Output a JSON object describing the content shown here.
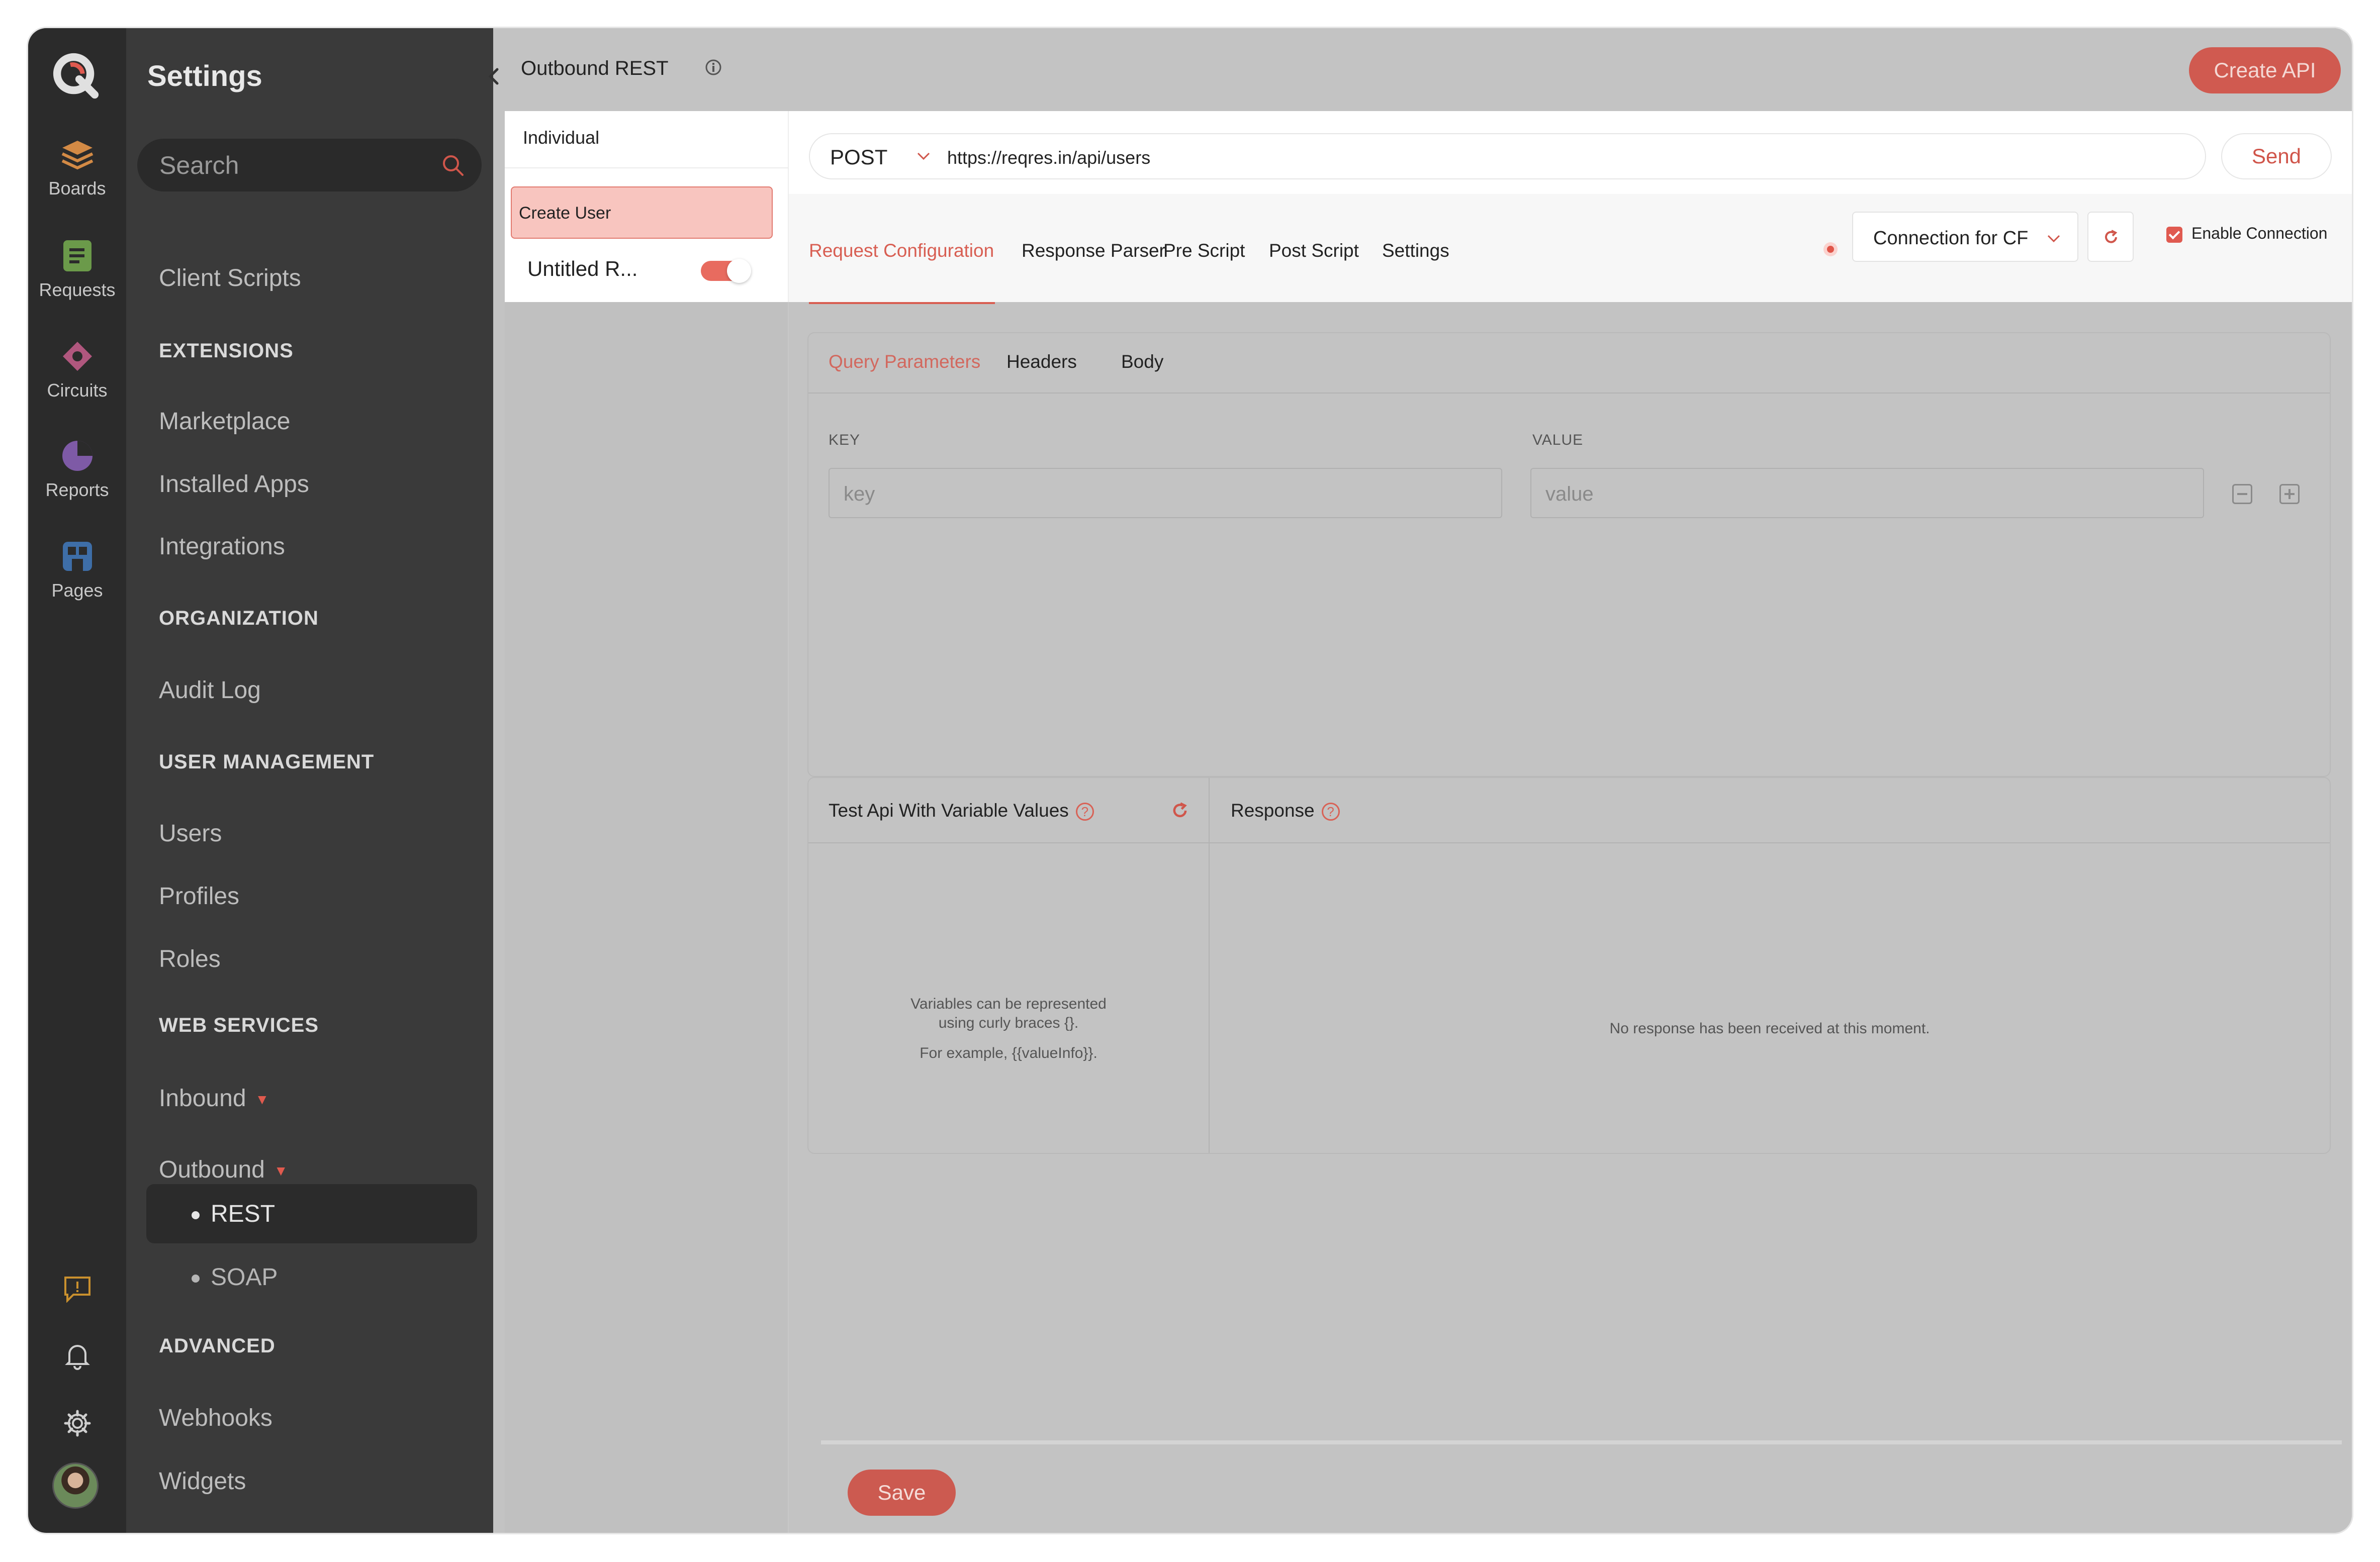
{
  "rail": {
    "items": [
      {
        "label": "Boards",
        "icon": "boards-icon"
      },
      {
        "label": "Requests",
        "icon": "requests-icon"
      },
      {
        "label": "Circuits",
        "icon": "circuits-icon"
      },
      {
        "label": "Reports",
        "icon": "reports-icon"
      },
      {
        "label": "Pages",
        "icon": "pages-icon"
      }
    ],
    "bottom_icons": [
      "feedback-icon",
      "bell-icon",
      "gear-icon",
      "avatar"
    ]
  },
  "sidebar": {
    "title": "Settings",
    "search_placeholder": "Search",
    "client_scripts": "Client Scripts",
    "sections": {
      "extensions": "EXTENSIONS",
      "organization": "ORGANIZATION",
      "user_management": "USER MANAGEMENT",
      "web_services": "WEB SERVICES",
      "advanced": "ADVANCED"
    },
    "items": {
      "marketplace": "Marketplace",
      "installed_apps": "Installed Apps",
      "integrations": "Integrations",
      "audit_log": "Audit Log",
      "users": "Users",
      "profiles": "Profiles",
      "roles": "Roles",
      "inbound": "Inbound",
      "outbound": "Outbound",
      "rest": "REST",
      "soap": "SOAP",
      "webhooks": "Webhooks",
      "widgets": "Widgets"
    }
  },
  "header": {
    "title": "Outbound REST",
    "create_api": "Create API"
  },
  "list_pane": {
    "tab": "Individual",
    "selected_item": "Create User",
    "item2": "Untitled R...",
    "item2_enabled": true
  },
  "request": {
    "method": "POST",
    "url": "https://reqres.in/api/users",
    "send_label": "Send"
  },
  "config_tabs": [
    "Request Configuration",
    "Response Parser",
    "Pre Script",
    "Post Script",
    "Settings"
  ],
  "active_config_tab": "Request Configuration",
  "connection": {
    "selected": "Connection for CF",
    "enable_label": "Enable Connection",
    "enabled": true
  },
  "params": {
    "tabs": [
      "Query Parameters",
      "Headers",
      "Body"
    ],
    "active_tab": "Query Parameters",
    "key_header": "KEY",
    "value_header": "VALUE",
    "key_placeholder": "key",
    "value_placeholder": "value"
  },
  "test_panel": {
    "title": "Test Api With Variable Values",
    "hint_line1": "Variables can be represented",
    "hint_line2": "using curly braces {}.",
    "hint_line3": "For example, {{valueInfo}}.",
    "response_title": "Response",
    "no_response": "No response has been received at this moment."
  },
  "footer": {
    "save_label": "Save"
  },
  "colors": {
    "accent": "#d85e52",
    "sidebar_bg": "#3a3a3a",
    "rail_bg": "#2b2b2b"
  }
}
